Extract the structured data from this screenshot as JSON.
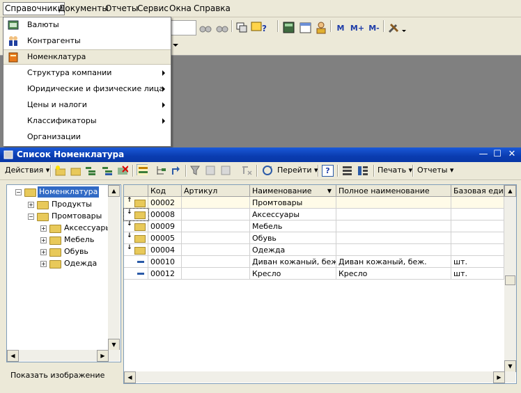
{
  "menubar": {
    "items": [
      "Справочники",
      "Документы",
      "Отчеты",
      "Сервис",
      "Окна",
      "Справка"
    ]
  },
  "toolbar": {
    "m_label": "М",
    "mplus_label": "М+",
    "mminus_label": "М-"
  },
  "dropdown": {
    "items": [
      {
        "label": "Валюты",
        "icon": "currency-icon",
        "submenu": false
      },
      {
        "label": "Контрагенты",
        "icon": "people-icon",
        "submenu": false
      },
      {
        "label": "Номенклатура",
        "icon": "book-icon",
        "submenu": false,
        "highlighted": true
      },
      {
        "label": "Структура компании",
        "submenu": true
      },
      {
        "label": "Юридические и физические лица",
        "submenu": true
      },
      {
        "label": "Цены и налоги",
        "submenu": true
      },
      {
        "label": "Классификаторы",
        "submenu": true
      },
      {
        "label": "Организации",
        "submenu": false
      }
    ]
  },
  "window": {
    "title": "Список Номенклатура",
    "actions_label": "Действия",
    "goto_label": "Перейти",
    "help_label": "?",
    "print_label": "Печать",
    "reports_label": "Отчеты",
    "show_image_label": "Показать изображение"
  },
  "tree": {
    "root": "Номенклатура",
    "children": [
      {
        "label": "Продукты",
        "expanded": false
      },
      {
        "label": "Промтовары",
        "expanded": true,
        "children": [
          "Аксессуары",
          "Мебель",
          "Обувь",
          "Одежда"
        ]
      }
    ]
  },
  "grid": {
    "columns": [
      "Код",
      "Артикул",
      "Наименование",
      "Полное наименование",
      "Базовая един..."
    ],
    "rows": [
      {
        "kind": "group-up",
        "code": "00002",
        "article": "",
        "name": "Промтовары",
        "full_name": "",
        "unit": ""
      },
      {
        "kind": "group",
        "code": "00008",
        "article": "",
        "name": "Аксессуары",
        "full_name": "",
        "unit": ""
      },
      {
        "kind": "group",
        "code": "00009",
        "article": "",
        "name": "Мебель",
        "full_name": "",
        "unit": ""
      },
      {
        "kind": "group",
        "code": "00005",
        "article": "",
        "name": "Обувь",
        "full_name": "",
        "unit": ""
      },
      {
        "kind": "group",
        "code": "00004",
        "article": "",
        "name": "Одежда",
        "full_name": "",
        "unit": ""
      },
      {
        "kind": "item",
        "code": "00010",
        "article": "",
        "name": "Диван кожаный, беж.",
        "full_name": "Диван кожаный, беж.",
        "unit": "шт."
      },
      {
        "kind": "item",
        "code": "00012",
        "article": "",
        "name": "Кресло",
        "full_name": "Кресло",
        "unit": "шт."
      }
    ]
  },
  "colors": {
    "titlebar": "#0a3cb0",
    "selection": "#316ac5",
    "panel": "#ece9d8"
  }
}
